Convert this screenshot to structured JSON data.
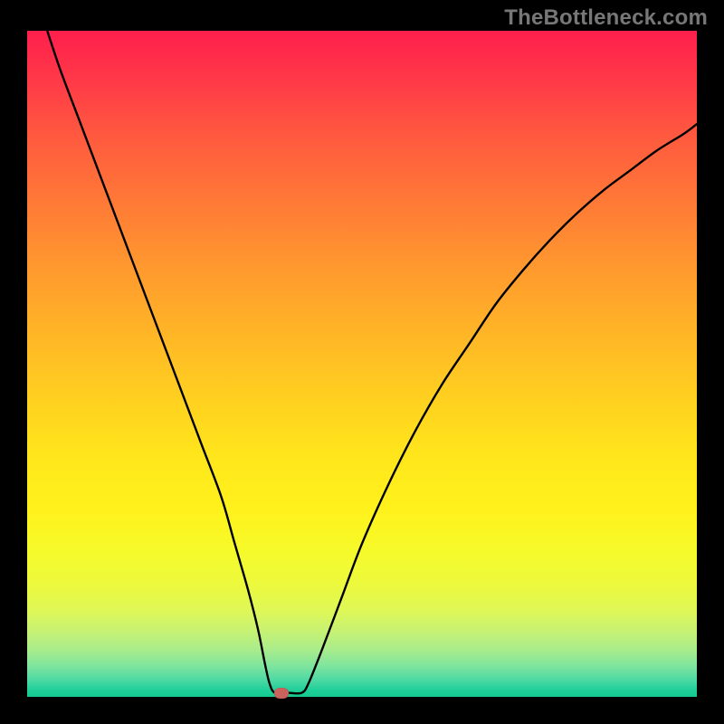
{
  "watermark": "TheBottleneck.com",
  "chart_data": {
    "type": "line",
    "title": "",
    "xlabel": "",
    "ylabel": "",
    "xlim": [
      0,
      100
    ],
    "ylim": [
      0,
      100
    ],
    "series": [
      {
        "name": "bottleneck-curve",
        "x": [
          3,
          5,
          8,
          11,
          14,
          17,
          20,
          23,
          26,
          29,
          31,
          33,
          34.5,
          35.5,
          36.2,
          37,
          39,
          41,
          42,
          44,
          47,
          50,
          54,
          58,
          62,
          66,
          70,
          74,
          78,
          82,
          86,
          90,
          94,
          98,
          100
        ],
        "y": [
          100,
          94,
          86,
          78,
          70,
          62,
          54,
          46,
          38,
          30,
          23,
          16,
          10,
          5,
          2,
          0.6,
          0.6,
          0.6,
          2,
          7,
          15,
          23,
          32,
          40,
          47,
          53,
          59,
          64,
          68.5,
          72.5,
          76,
          79,
          82,
          84.5,
          86
        ]
      }
    ],
    "annotations": [
      {
        "name": "optimal-marker",
        "x": 38,
        "y": 0.6
      }
    ],
    "background_gradient": {
      "top": "#ff1f4c",
      "mid": "#ffe61c",
      "bottom": "#14c98f"
    }
  }
}
